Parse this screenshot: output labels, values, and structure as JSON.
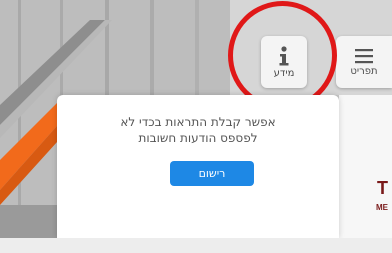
{
  "header": {
    "menu": {
      "label": "תפריט",
      "icon": "hamburger-menu-icon"
    },
    "info": {
      "label": "מידע",
      "icon": "info-icon"
    }
  },
  "popup": {
    "message_line1": "אפשר קבלת התראות בכדי לא",
    "message_line2": "לפספס הודעות חשובות",
    "register_label": "רישום"
  },
  "background_sign": {
    "big": "T",
    "small": "ME"
  },
  "colors": {
    "accent": "#1e88e5",
    "highlight_ring": "#e01818",
    "background_orange": "#f26a1b"
  }
}
